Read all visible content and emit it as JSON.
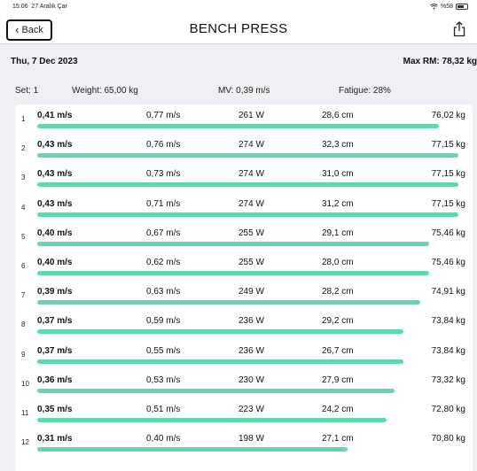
{
  "status": {
    "time": "15:06",
    "date": "27 Aralık Çar",
    "battery": "%58"
  },
  "nav": {
    "back_label": "Back",
    "title": "BENCH PRESS"
  },
  "session": {
    "date": "Thu, 7 Dec 2023",
    "max_rm": "Max RM: 78,32 kg"
  },
  "set_summary": {
    "set": "Set: 1",
    "weight": "Weight: 65,00 kg",
    "mv": "MV: 0,39 m/s",
    "fatigue": "Fatigue: 28%"
  },
  "colors": {
    "bar": "#62d6b2",
    "background": "#eef0f5"
  },
  "reps": [
    {
      "num": "1",
      "mean_velocity": "0,41 m/s",
      "peak_velocity": "0,77 m/s",
      "power": "261 W",
      "rom": "28,6 cm",
      "load": "76,02 kg",
      "bar_fraction": 0.943
    },
    {
      "num": "2",
      "mean_velocity": "0,43 m/s",
      "peak_velocity": "0,76 m/s",
      "power": "274 W",
      "rom": "32,3 cm",
      "load": "77,15 kg",
      "bar_fraction": 0.99
    },
    {
      "num": "3",
      "mean_velocity": "0,43 m/s",
      "peak_velocity": "0,73 m/s",
      "power": "274 W",
      "rom": "31,0 cm",
      "load": "77,15 kg",
      "bar_fraction": 0.99
    },
    {
      "num": "4",
      "mean_velocity": "0,43 m/s",
      "peak_velocity": "0,71 m/s",
      "power": "274 W",
      "rom": "31,2 cm",
      "load": "77,15 kg",
      "bar_fraction": 0.99
    },
    {
      "num": "5",
      "mean_velocity": "0,40 m/s",
      "peak_velocity": "0,67 m/s",
      "power": "255 W",
      "rom": "29,1 cm",
      "load": "75,46 kg",
      "bar_fraction": 0.92
    },
    {
      "num": "6",
      "mean_velocity": "0,40 m/s",
      "peak_velocity": "0,62 m/s",
      "power": "255 W",
      "rom": "28,0 cm",
      "load": "75,46 kg",
      "bar_fraction": 0.92
    },
    {
      "num": "7",
      "mean_velocity": "0,39 m/s",
      "peak_velocity": "0,63 m/s",
      "power": "249 W",
      "rom": "28,2 cm",
      "load": "74,91 kg",
      "bar_fraction": 0.9
    },
    {
      "num": "8",
      "mean_velocity": "0,37 m/s",
      "peak_velocity": "0,59 m/s",
      "power": "236 W",
      "rom": "29,2 cm",
      "load": "73,84 kg",
      "bar_fraction": 0.86
    },
    {
      "num": "9",
      "mean_velocity": "0,37 m/s",
      "peak_velocity": "0,55 m/s",
      "power": "236 W",
      "rom": "26,7 cm",
      "load": "73,84 kg",
      "bar_fraction": 0.86
    },
    {
      "num": "10",
      "mean_velocity": "0,36 m/s",
      "peak_velocity": "0,53 m/s",
      "power": "230 W",
      "rom": "27,9 cm",
      "load": "73,32 kg",
      "bar_fraction": 0.84
    },
    {
      "num": "11",
      "mean_velocity": "0,35 m/s",
      "peak_velocity": "0,51 m/s",
      "power": "223 W",
      "rom": "24,2 cm",
      "load": "72,80 kg",
      "bar_fraction": 0.82
    },
    {
      "num": "12",
      "mean_velocity": "0,31 m/s",
      "peak_velocity": "0,40 m/s",
      "power": "198 W",
      "rom": "27,1 cm",
      "load": "70,80 kg",
      "bar_fraction": 0.73
    }
  ]
}
